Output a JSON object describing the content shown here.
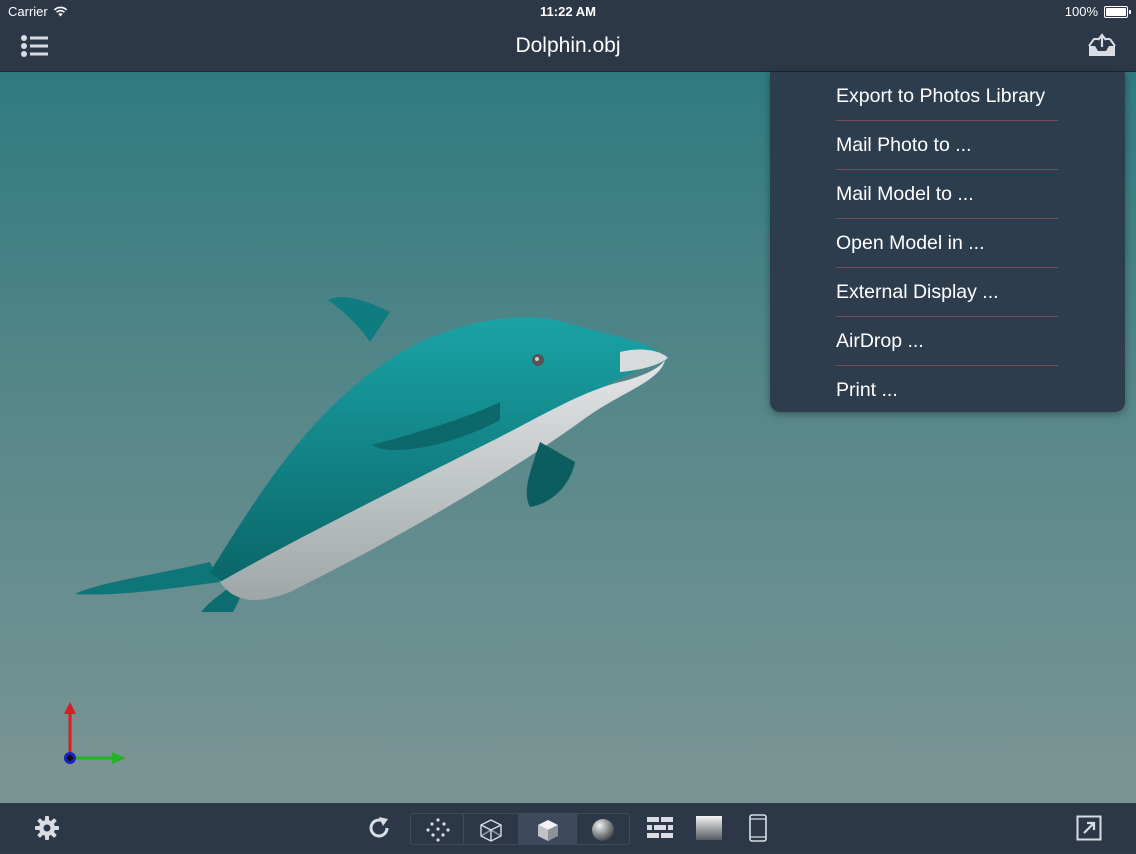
{
  "status_bar": {
    "carrier": "Carrier",
    "time": "11:22 AM",
    "battery": "100%",
    "battery_level": 1.0,
    "wifi_icon": "wifi-icon",
    "battery_icon": "battery-icon"
  },
  "nav": {
    "title": "Dolphin.obj",
    "left_icon": "list-icon",
    "right_icon": "share-tray-icon"
  },
  "share_menu": {
    "items": [
      "Export to Photos Library",
      "Mail Photo to ...",
      "Mail Model to ...",
      "Open Model in ...",
      "External Display ...",
      "AirDrop ...",
      "Print ..."
    ]
  },
  "viewport": {
    "model": "dolphin-model",
    "axes": "axes-gizmo-icon",
    "colors": {
      "top": "#2f7a80",
      "bottom": "#7c9594",
      "model": "#117f82"
    }
  },
  "toolbar": {
    "icons": [
      "gear-icon",
      "refresh-icon",
      "points-icon",
      "wireframe-cube-icon",
      "solid-cube-icon",
      "sphere-icon",
      "texture-brick-icon",
      "gradient-icon",
      "device-icon",
      "expand-icon"
    ],
    "selected_render_mode": "solid-cube"
  }
}
